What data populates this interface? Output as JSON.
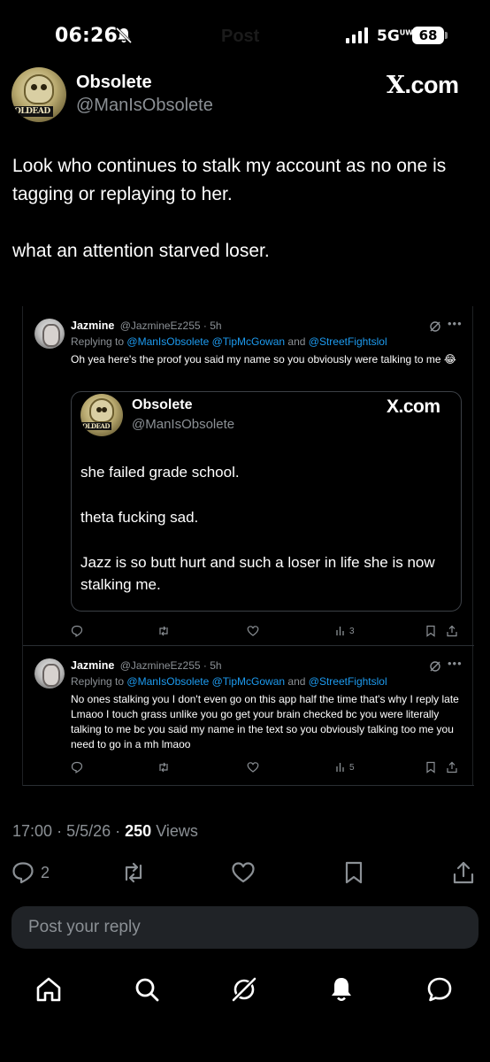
{
  "status_bar": {
    "time": "06:26",
    "network": "5G",
    "network_sup": "UW",
    "battery": "68",
    "ghost_title": "Post"
  },
  "post": {
    "author": {
      "name": "Obsolete",
      "handle": "@ManIsObsolete",
      "avatar_tag": "OLDEAD"
    },
    "brand": {
      "x": "X",
      "suffix": ".com"
    },
    "body": [
      "Look who continues to stalk my account as no one is tagging or replaying to her.",
      "what an attention starved loser."
    ],
    "meta": {
      "time": "17:00",
      "date": "5/5/26",
      "views_count": "250",
      "views_label": "Views",
      "sep": "·"
    },
    "actions": {
      "replies": "2"
    }
  },
  "embed": {
    "replies": [
      {
        "name": "Jazmine",
        "handle": "@JazmineEz255",
        "time": "· 5h",
        "replying_prefix": "Replying to",
        "replying_to": "@ManIsObsolete @TipMcGowan",
        "replying_and": "and",
        "replying_last": "@StreetFightslol",
        "text": "Oh yea here's the proof you said my name so you obviously were talking to me 😂",
        "views": "3"
      },
      {
        "name": "Jazmine",
        "handle": "@JazmineEz255",
        "time": "· 5h",
        "replying_prefix": "Replying to",
        "replying_to": "@ManIsObsolete @TipMcGowan",
        "replying_and": "and",
        "replying_last": "@StreetFightslol",
        "text": "No ones stalking you I don't even go on this app half the time that's why I reply late Lmaoo I touch grass unlike you go get your brain checked bc you were literally talking to me bc you said my name in the text so you obviously talking too me you need to go in a mh lmaoo",
        "views": "5"
      }
    ],
    "quote": {
      "name": "Obsolete",
      "handle": "@ManIsObsolete",
      "avatar_tag": "OLDEAD",
      "body": [
        "she failed grade school.",
        "theta fucking sad.",
        "Jazz is so butt hurt and such a loser in life she is now stalking me."
      ]
    }
  },
  "reply_box": {
    "placeholder": "Post your reply"
  },
  "icons": {
    "reply": "reply-icon",
    "retweet": "repost-icon",
    "like": "heart-icon",
    "bookmark": "bookmark-icon",
    "share": "share-icon",
    "home": "home-icon",
    "search": "search-icon",
    "grok": "grok-icon",
    "notifications": "bell-icon",
    "messages": "messages-icon"
  },
  "colors": {
    "background": "#000000",
    "link": "#1d9bf0",
    "muted": "#8b9095",
    "reply_box": "#202327"
  }
}
